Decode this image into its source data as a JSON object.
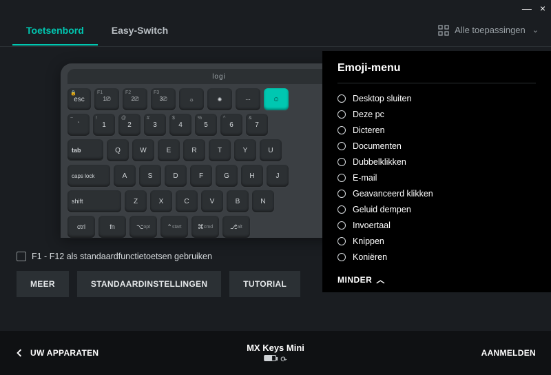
{
  "window": {
    "min": "—",
    "close": "×"
  },
  "tabs": {
    "keyboard": "Toetsenbord",
    "easyswitch": "Easy-Switch"
  },
  "apps": {
    "label": "Alle toepassingen"
  },
  "keyboard": {
    "brand": "logi",
    "row1": [
      "esc",
      "1⎚",
      "2⎚",
      "3⎚",
      "☼",
      "✺",
      "⋯",
      "☺"
    ],
    "row2_top": [
      "~",
      "!",
      "@",
      "#",
      "$",
      "%",
      "^",
      "&"
    ],
    "row2_bot": [
      "`",
      "1",
      "2",
      "3",
      "4",
      "5",
      "6",
      "7"
    ],
    "row3": [
      "tab",
      "Q",
      "W",
      "E",
      "R",
      "T",
      "Y",
      "U"
    ],
    "row4": [
      "caps lock",
      "A",
      "S",
      "D",
      "F",
      "G",
      "H",
      "J"
    ],
    "row5": [
      "shift",
      "Z",
      "X",
      "C",
      "V",
      "B",
      "N"
    ],
    "row6_labels": [
      [
        "ctrl",
        ""
      ],
      [
        "fn",
        ""
      ],
      [
        "⌥",
        "opt"
      ],
      [
        "⌃",
        "start"
      ],
      [
        "⌘",
        "cmd"
      ],
      [
        "⎇",
        "alt"
      ]
    ]
  },
  "std_checkbox": "F1 - F12 als standaardfunctietoetsen gebruiken",
  "buttons": {
    "more": "MEER",
    "defaults": "STANDAARDINSTELLINGEN",
    "tutorial": "TUTORIAL"
  },
  "panel": {
    "title": "Emoji-menu",
    "items": [
      "Desktop sluiten",
      "Deze pc",
      "Dicteren",
      "Documenten",
      "Dubbelklikken",
      "E-mail",
      "Geavanceerd klikken",
      "Geluid dempen",
      "Invoertaal",
      "Knippen",
      "Koniëren"
    ],
    "less": "MINDER"
  },
  "bottom": {
    "back": "UW APPARATEN",
    "device": "MX Keys Mini",
    "login": "AANMELDEN"
  }
}
